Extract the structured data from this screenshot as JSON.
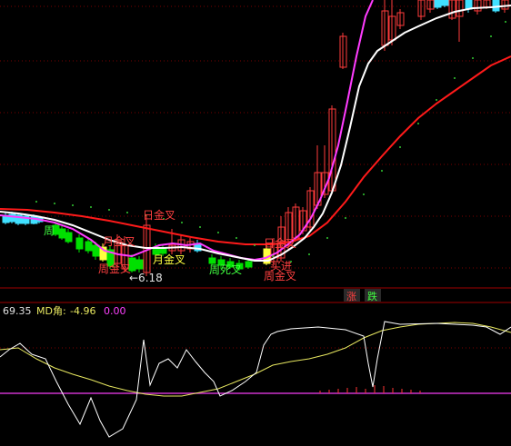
{
  "colors": {
    "background": "#000000",
    "grid": "#7a0000",
    "separator": "#a00000",
    "up_candle": "#ff3b3b",
    "down_candle_cyan": "#40e0ff",
    "down_candle_green": "#00e000",
    "ma_white": "#ffffff",
    "ma_magenta": "#ff3cff",
    "ma_red": "#ff1a1a",
    "ma_dotted_green": "#33cc33",
    "signal_red": "#ff4040",
    "signal_yellow": "#ffff40",
    "signal_green": "#40ff40",
    "md_line": "#ffffff",
    "md_signal": "#e8e860",
    "md_zero": "#cc33cc",
    "hist_red": "#ff3333"
  },
  "main_panel": {
    "annotations": [
      {
        "text": "日金叉",
        "color": "signal_red"
      },
      {
        "text": "月金叉",
        "color": "signal_red"
      },
      {
        "text": "周金叉",
        "color": "signal_red"
      },
      {
        "text": "月金叉",
        "color": "signal_yellow"
      },
      {
        "text": "周死叉",
        "color": "signal_green"
      },
      {
        "text": "日金叉",
        "color": "signal_red"
      },
      {
        "text": "买进",
        "color": "signal_red"
      },
      {
        "text": "周金叉",
        "color": "signal_red"
      },
      {
        "text": "周",
        "color": "signal_green"
      }
    ],
    "low_marker": "←6.18",
    "rise_label": "涨",
    "fall_label": "跌"
  },
  "indicator_panel": {
    "value1": "69.35",
    "name": "MD角:",
    "value2": "-4.96",
    "value3": "0.00"
  }
}
